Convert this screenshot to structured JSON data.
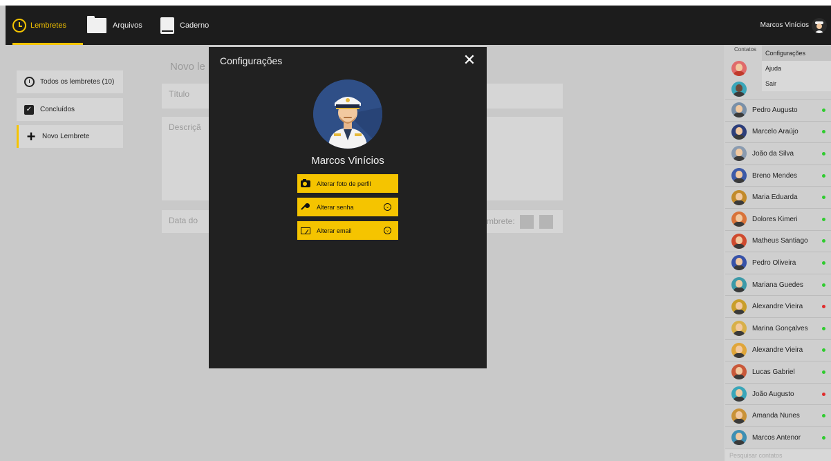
{
  "header": {
    "nav": [
      {
        "label": "Lembretes",
        "icon": "clock-icon",
        "active": true
      },
      {
        "label": "Arquivos",
        "icon": "folder-icon"
      },
      {
        "label": "Caderno",
        "icon": "notebook-icon"
      }
    ],
    "user_name": "Marcos Vinícios"
  },
  "sidebar": {
    "items": [
      {
        "label": "Todos os lembretes (10)",
        "icon": "clock-icon"
      },
      {
        "label": "Concluídos",
        "icon": "checkbox-icon"
      },
      {
        "label": "Novo Lembrete",
        "icon": "plus-icon"
      }
    ]
  },
  "form": {
    "title": "Novo le",
    "titulo_placeholder": "Título",
    "descricao_placeholder": "Descriçã",
    "data_label": "Data do",
    "lembrete_label": "mbrete:"
  },
  "contacts": {
    "tab_label": "Contatos",
    "items": [
      {
        "name": "Pedro Augusto",
        "status": "online",
        "avatar_color": "#7a90a8"
      },
      {
        "name": "Marcelo Araújo",
        "status": "online",
        "avatar_color": "#2d3e7a"
      },
      {
        "name": "João da Silva",
        "status": "online",
        "avatar_color": "#8a9bb0"
      },
      {
        "name": "Breno Mendes",
        "status": "online",
        "avatar_color": "#3d5aa8"
      },
      {
        "name": "Maria Eduarda",
        "status": "online",
        "avatar_color": "#c28a2a"
      },
      {
        "name": "Dolores Kimeri",
        "status": "online",
        "avatar_color": "#d9733a"
      },
      {
        "name": "Matheus Santiago",
        "status": "online",
        "avatar_color": "#cf4a2f"
      },
      {
        "name": "Pedro Oliveira",
        "status": "online",
        "avatar_color": "#3752a8"
      },
      {
        "name": "Mariana Guedes",
        "status": "online",
        "avatar_color": "#3d9aa8"
      },
      {
        "name": "Alexandre Vieira",
        "status": "busy",
        "avatar_color": "#c99e2a"
      },
      {
        "name": "Marina Gonçalves",
        "status": "online",
        "avatar_color": "#d8b04a"
      },
      {
        "name": "Alexandre Vieira",
        "status": "online",
        "avatar_color": "#e0a63a"
      },
      {
        "name": "Lucas Gabriel",
        "status": "online",
        "avatar_color": "#c9583a"
      },
      {
        "name": "João Augusto",
        "status": "busy",
        "avatar_color": "#3aa6b9"
      },
      {
        "name": "Amanda Nunes",
        "status": "online",
        "avatar_color": "#c99237"
      },
      {
        "name": "Marcos Antenor",
        "status": "online",
        "avatar_color": "#3e8fb3"
      }
    ],
    "search_placeholder": "Pesquisar contatos"
  },
  "user_menu": {
    "items": [
      "Configurações",
      "Ajuda",
      "Sair"
    ]
  },
  "modal": {
    "title": "Configurações",
    "user_name": "Marcos Vinícios",
    "actions": [
      {
        "label": "Alterar foto de perfil",
        "icon": "camera-icon",
        "has_chevron": false
      },
      {
        "label": "Alterar senha",
        "icon": "key-icon",
        "has_chevron": true
      },
      {
        "label": "Alterar email",
        "icon": "envelope-icon",
        "has_chevron": true
      }
    ]
  },
  "colors": {
    "accent": "#f5c400",
    "topbar": "#1c1c1c",
    "modal_bg": "#212121",
    "online": "#2ecc2e",
    "busy": "#e02b2b"
  }
}
